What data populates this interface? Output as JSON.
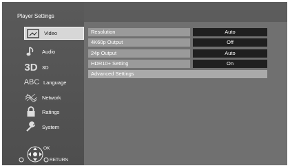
{
  "header": {
    "title": "Player Settings"
  },
  "sidebar": {
    "items": [
      {
        "label": "Video",
        "icon": "video-icon",
        "active": true
      },
      {
        "label": "Audio",
        "icon": "music-note-icon"
      },
      {
        "label": "3D",
        "icon": "3d-icon"
      },
      {
        "label": "Language",
        "icon": "abc-icon"
      },
      {
        "label": "Network",
        "icon": "network-icon"
      },
      {
        "label": "Ratings",
        "icon": "lock-icon"
      },
      {
        "label": "System",
        "icon": "wrench-icon"
      }
    ]
  },
  "settings": {
    "rows": [
      {
        "label": "Resolution",
        "value": "Auto"
      },
      {
        "label": "4K60p Output",
        "value": "Off"
      },
      {
        "label": "24p Output",
        "value": "Auto"
      },
      {
        "label": "HDR10+ Setting",
        "value": "On"
      }
    ],
    "advanced_label": "Advanced Settings"
  },
  "footer": {
    "ok_label": "OK",
    "return_label": "RETURN"
  },
  "badge_3d": "3D",
  "badge_abc": "ABC"
}
